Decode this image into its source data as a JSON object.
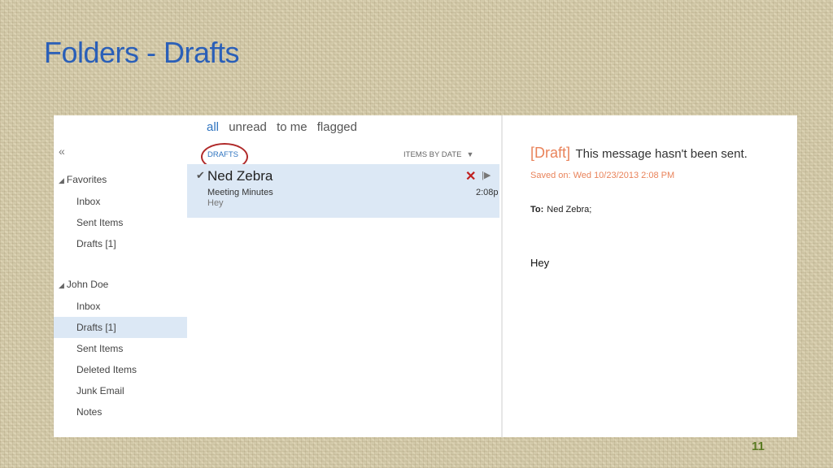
{
  "slide": {
    "title": "Folders - Drafts",
    "page_number": "11"
  },
  "filters": [
    "all",
    "unread",
    "to me",
    "flagged"
  ],
  "filters_active": "all",
  "folders": {
    "collapse_glyph": "«",
    "favorites_label": "Favorites",
    "favorites_items": [
      "Inbox",
      "Sent Items",
      "Drafts [1]"
    ],
    "account_label": "John Doe",
    "account_items": [
      "Inbox",
      "Drafts [1]",
      "Sent Items",
      "Deleted Items",
      "Junk Email",
      "Notes"
    ],
    "selected": "Drafts [1]"
  },
  "list": {
    "header": "DRAFTS",
    "sort_label": "ITEMS BY DATE",
    "messages": [
      {
        "sender": "Ned Zebra",
        "subject": "Meeting Minutes",
        "preview": "Hey",
        "time": "2:08p"
      }
    ]
  },
  "reading": {
    "draft_tag": "[Draft]",
    "draft_message": "This message hasn't been sent.",
    "saved_on": "Saved on: Wed 10/23/2013 2:08 PM",
    "to_label": "To:",
    "to_value": "Ned Zebra;",
    "body": "Hey"
  },
  "colors": {
    "title": "#2a5fb8",
    "accent": "#2f74c0",
    "draft": "#e9835a",
    "selection": "#dce8f5",
    "annotation_circle": "#b02a2a",
    "page_number": "#5a7a22"
  },
  "icons": [
    "check-icon",
    "delete-icon",
    "flag-icon",
    "collapse-icon",
    "expand-triangle-icon",
    "sort-caret-icon"
  ]
}
